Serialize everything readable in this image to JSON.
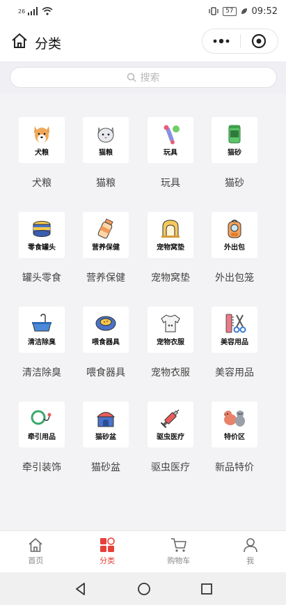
{
  "status": {
    "signal": "26",
    "battery": "57",
    "time": "09:52"
  },
  "header": {
    "title": "分类"
  },
  "search": {
    "placeholder": "搜索"
  },
  "categories": [
    {
      "tile": "犬粮",
      "name": "犬粮",
      "icon": "dog-icon"
    },
    {
      "tile": "猫粮",
      "name": "猫粮",
      "icon": "cat-icon"
    },
    {
      "tile": "玩具",
      "name": "玩具",
      "icon": "toy-icon"
    },
    {
      "tile": "猫砂",
      "name": "猫砂",
      "icon": "litter-bag-icon"
    },
    {
      "tile": "零食罐头",
      "name": "罐头零食",
      "icon": "can-icon"
    },
    {
      "tile": "营养保健",
      "name": "营养保健",
      "icon": "bottle-icon"
    },
    {
      "tile": "宠物窝垫",
      "name": "宠物窝垫",
      "icon": "pet-house-icon"
    },
    {
      "tile": "外出包",
      "name": "外出包笼",
      "icon": "backpack-icon"
    },
    {
      "tile": "清洁除臭",
      "name": "清洁除臭",
      "icon": "bathtub-icon"
    },
    {
      "tile": "喂食器具",
      "name": "喂食器具",
      "icon": "bowl-icon"
    },
    {
      "tile": "宠物衣服",
      "name": "宠物衣服",
      "icon": "shirt-icon"
    },
    {
      "tile": "美容用品",
      "name": "美容用品",
      "icon": "comb-scissors-icon"
    },
    {
      "tile": "牵引用品",
      "name": "牵引装饰",
      "icon": "leash-icon"
    },
    {
      "tile": "猫砂盆",
      "name": "猫砂盆",
      "icon": "litter-box-icon"
    },
    {
      "tile": "驱虫医疗",
      "name": "驱虫医疗",
      "icon": "syringe-icon"
    },
    {
      "tile": "特价区",
      "name": "新品特价",
      "icon": "pets-icon"
    }
  ],
  "tabbar": [
    {
      "label": "首页",
      "icon": "home-icon"
    },
    {
      "label": "分类",
      "icon": "category-icon",
      "active": true
    },
    {
      "label": "购物车",
      "icon": "cart-icon"
    },
    {
      "label": "我",
      "icon": "user-icon"
    }
  ],
  "colors": {
    "accent": "#e5403a"
  }
}
